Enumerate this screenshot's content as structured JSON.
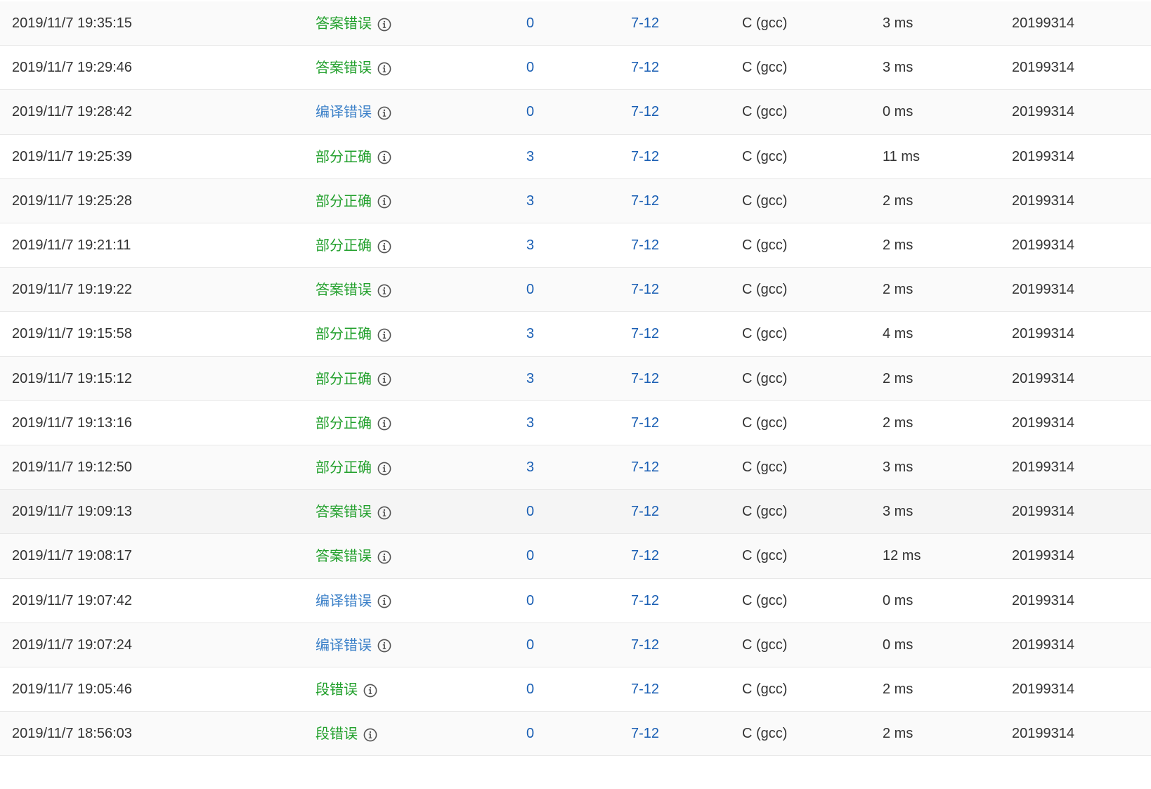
{
  "colors": {
    "accepted_like": "#22a02c",
    "compile_error": "#3b80c8",
    "link": "#1a5fb4",
    "text": "#333333",
    "row_alt": "#fafafa",
    "row_hover": "#f5f5f5",
    "divider": "#e8e8e8"
  },
  "submissions": [
    {
      "time": "2019/11/7 19:35:15",
      "status": "答案错误",
      "status_color": "green",
      "score": "0",
      "problem": "7-12",
      "compiler": "C (gcc)",
      "time_cost": "3 ms",
      "user": "20199314"
    },
    {
      "time": "2019/11/7 19:29:46",
      "status": "答案错误",
      "status_color": "green",
      "score": "0",
      "problem": "7-12",
      "compiler": "C (gcc)",
      "time_cost": "3 ms",
      "user": "20199314"
    },
    {
      "time": "2019/11/7 19:28:42",
      "status": "编译错误",
      "status_color": "blue",
      "score": "0",
      "problem": "7-12",
      "compiler": "C (gcc)",
      "time_cost": "0 ms",
      "user": "20199314"
    },
    {
      "time": "2019/11/7 19:25:39",
      "status": "部分正确",
      "status_color": "green",
      "score": "3",
      "problem": "7-12",
      "compiler": "C (gcc)",
      "time_cost": "11 ms",
      "user": "20199314"
    },
    {
      "time": "2019/11/7 19:25:28",
      "status": "部分正确",
      "status_color": "green",
      "score": "3",
      "problem": "7-12",
      "compiler": "C (gcc)",
      "time_cost": "2 ms",
      "user": "20199314"
    },
    {
      "time": "2019/11/7 19:21:11",
      "status": "部分正确",
      "status_color": "green",
      "score": "3",
      "problem": "7-12",
      "compiler": "C (gcc)",
      "time_cost": "2 ms",
      "user": "20199314"
    },
    {
      "time": "2019/11/7 19:19:22",
      "status": "答案错误",
      "status_color": "green",
      "score": "0",
      "problem": "7-12",
      "compiler": "C (gcc)",
      "time_cost": "2 ms",
      "user": "20199314"
    },
    {
      "time": "2019/11/7 19:15:58",
      "status": "部分正确",
      "status_color": "green",
      "score": "3",
      "problem": "7-12",
      "compiler": "C (gcc)",
      "time_cost": "4 ms",
      "user": "20199314"
    },
    {
      "time": "2019/11/7 19:15:12",
      "status": "部分正确",
      "status_color": "green",
      "score": "3",
      "problem": "7-12",
      "compiler": "C (gcc)",
      "time_cost": "2 ms",
      "user": "20199314"
    },
    {
      "time": "2019/11/7 19:13:16",
      "status": "部分正确",
      "status_color": "green",
      "score": "3",
      "problem": "7-12",
      "compiler": "C (gcc)",
      "time_cost": "2 ms",
      "user": "20199314"
    },
    {
      "time": "2019/11/7 19:12:50",
      "status": "部分正确",
      "status_color": "green",
      "score": "3",
      "problem": "7-12",
      "compiler": "C (gcc)",
      "time_cost": "3 ms",
      "user": "20199314"
    },
    {
      "time": "2019/11/7 19:09:13",
      "status": "答案错误",
      "status_color": "green",
      "score": "0",
      "problem": "7-12",
      "compiler": "C (gcc)",
      "time_cost": "3 ms",
      "user": "20199314"
    },
    {
      "time": "2019/11/7 19:08:17",
      "status": "答案错误",
      "status_color": "green",
      "score": "0",
      "problem": "7-12",
      "compiler": "C (gcc)",
      "time_cost": "12 ms",
      "user": "20199314"
    },
    {
      "time": "2019/11/7 19:07:42",
      "status": "编译错误",
      "status_color": "blue",
      "score": "0",
      "problem": "7-12",
      "compiler": "C (gcc)",
      "time_cost": "0 ms",
      "user": "20199314"
    },
    {
      "time": "2019/11/7 19:07:24",
      "status": "编译错误",
      "status_color": "blue",
      "score": "0",
      "problem": "7-12",
      "compiler": "C (gcc)",
      "time_cost": "0 ms",
      "user": "20199314"
    },
    {
      "time": "2019/11/7 19:05:46",
      "status": "段错误",
      "status_color": "green",
      "score": "0",
      "problem": "7-12",
      "compiler": "C (gcc)",
      "time_cost": "2 ms",
      "user": "20199314"
    },
    {
      "time": "2019/11/7 18:56:03",
      "status": "段错误",
      "status_color": "green",
      "score": "0",
      "problem": "7-12",
      "compiler": "C (gcc)",
      "time_cost": "2 ms",
      "user": "20199314"
    }
  ]
}
